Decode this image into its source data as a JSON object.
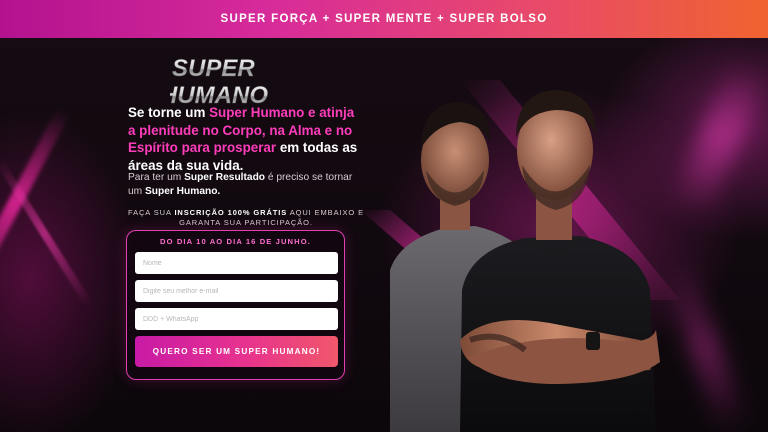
{
  "banner": {
    "text": "SUPER FORÇA + SUPER MENTE + SUPER BOLSO"
  },
  "logo": {
    "line1": "SUPER",
    "line2": "HUMANO"
  },
  "headline": {
    "p1": "Se torne um ",
    "h1": "Super Humano e atinja a plenitude no Corpo, na Alma e no Espírito para prosperar",
    "p2": " em todas as áreas da sua vida."
  },
  "subtext": {
    "p1": "Para ter um ",
    "b1": "Super Resultado",
    "p2": " é preciso se tornar um ",
    "b2": "Super Humano."
  },
  "cta_note": {
    "p1": "FAÇA SUA ",
    "b1": "INSCRIÇÃO 100% GRÁTIS",
    "p2": " AQUI EMBAIXO E GARANTA SUA PARTICIPAÇÃO."
  },
  "form": {
    "date_range": "DO DIA 10 AO DIA 16 DE JUNHO.",
    "name_placeholder": "Nome",
    "email_placeholder": "Digite seu melhor e-mail",
    "phone_placeholder": "DDD + WhatsApp",
    "submit_label": "QUERO SER UM SUPER HUMANO!"
  },
  "colors": {
    "accent_pink": "#ff3dbb",
    "banner_start": "#b3128f",
    "banner_end": "#f0632f"
  }
}
